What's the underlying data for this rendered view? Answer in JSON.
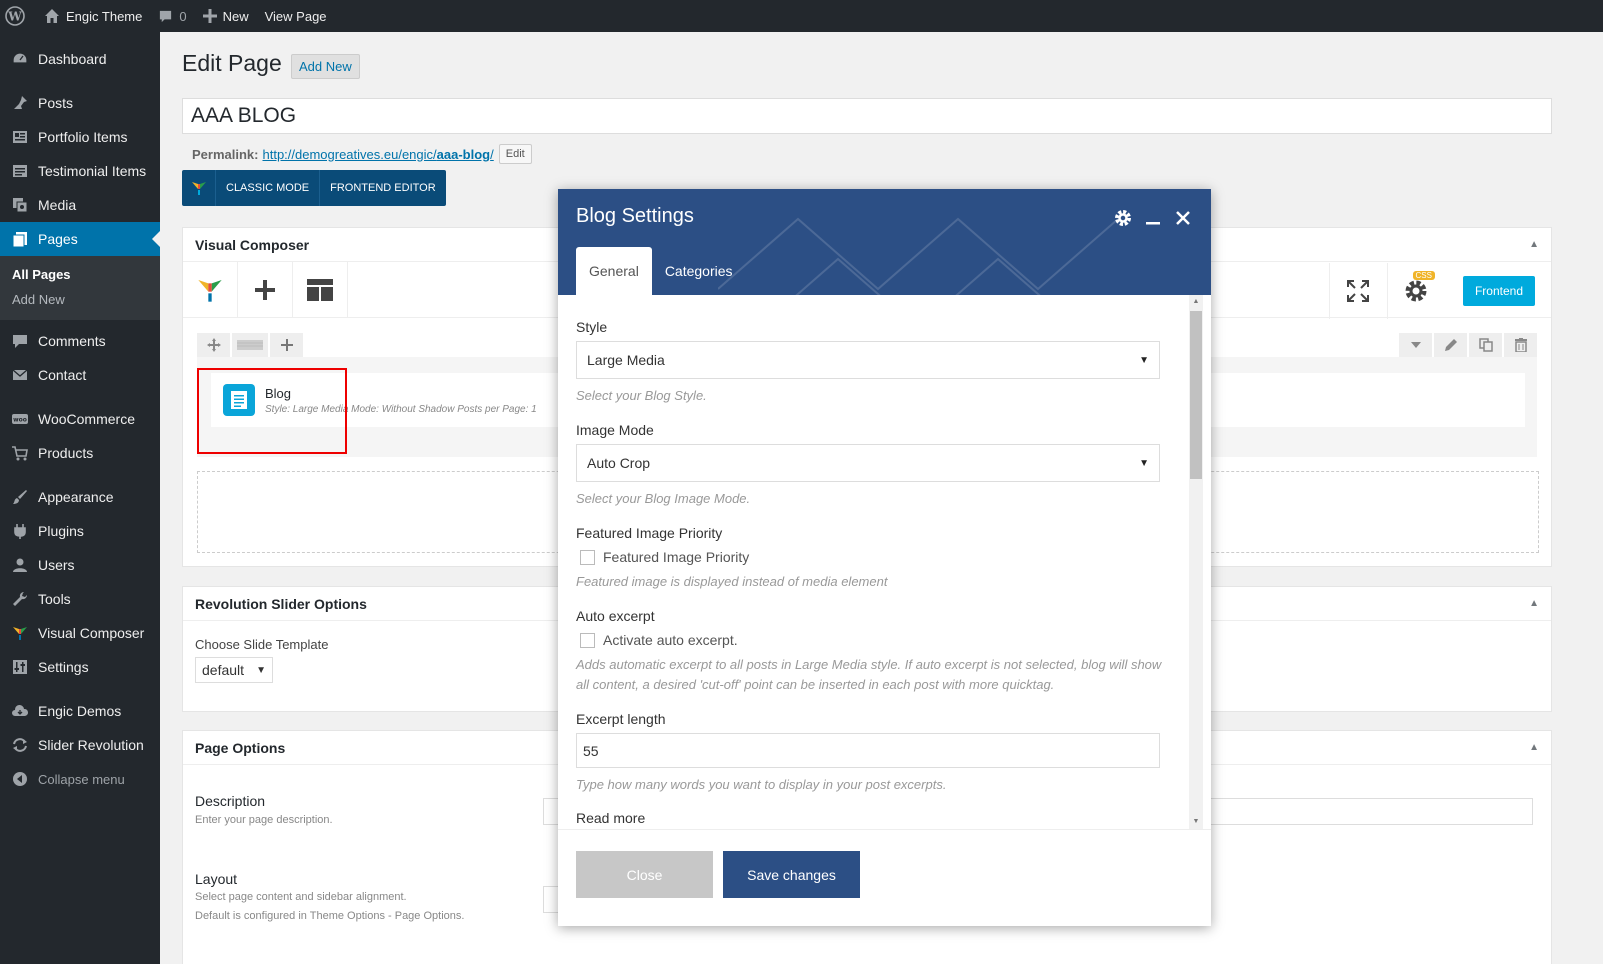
{
  "adminbar": {
    "site_name": "Engic Theme",
    "comments_count": "0",
    "new_label": "New",
    "view_page": "View Page"
  },
  "sidebar": {
    "items": [
      {
        "label": "Dashboard",
        "icon": "dashboard-icon"
      },
      {
        "label": "Posts",
        "icon": "pin-icon"
      },
      {
        "label": "Portfolio Items",
        "icon": "portfolio-icon"
      },
      {
        "label": "Testimonial Items",
        "icon": "testimonial-icon"
      },
      {
        "label": "Media",
        "icon": "media-icon"
      },
      {
        "label": "Pages",
        "icon": "pages-icon"
      },
      {
        "label": "Comments",
        "icon": "comments-icon"
      },
      {
        "label": "Contact",
        "icon": "mail-icon"
      },
      {
        "label": "WooCommerce",
        "icon": "woocommerce-icon"
      },
      {
        "label": "Products",
        "icon": "cart-icon"
      },
      {
        "label": "Appearance",
        "icon": "brush-icon"
      },
      {
        "label": "Plugins",
        "icon": "plugin-icon"
      },
      {
        "label": "Users",
        "icon": "users-icon"
      },
      {
        "label": "Tools",
        "icon": "wrench-icon"
      },
      {
        "label": "Visual Composer",
        "icon": "vc-icon"
      },
      {
        "label": "Settings",
        "icon": "settings-icon"
      },
      {
        "label": "Engic Demos",
        "icon": "cloud-icon"
      },
      {
        "label": "Slider Revolution",
        "icon": "refresh-icon"
      },
      {
        "label": "Collapse menu",
        "icon": "collapse-icon"
      }
    ],
    "pages_sub": {
      "all": "All Pages",
      "add": "Add New"
    }
  },
  "main": {
    "title": "Edit Page",
    "add_new": "Add New",
    "post_title": "AAA BLOG",
    "permalink_label": "Permalink:",
    "permalink_base": "http://demogreatives.eu/engic/",
    "permalink_slug": "aaa-blog",
    "permalink_slash": "/",
    "permalink_edit": "Edit",
    "classic_mode": "CLASSIC MODE",
    "frontend_editor": "FRONTEND EDITOR"
  },
  "vc": {
    "title": "Visual Composer",
    "frontend": "Frontend",
    "css_badge": "CSS",
    "element_title": "Blog",
    "element_params": "Style: Large Media  Mode: Without Shadow  Posts per Page: 1"
  },
  "revolution": {
    "title": "Revolution Slider Options",
    "label": "Choose Slide Template",
    "value": "default"
  },
  "page_options": {
    "title": "Page Options",
    "desc_label": "Description",
    "desc_help": "Enter your page description.",
    "layout_label": "Layout",
    "layout_help1": "Select page content and sidebar alignment.",
    "layout_help2": "Default is configured in Theme Options - Page Options."
  },
  "modal": {
    "title": "Blog Settings",
    "tabs": [
      "General",
      "Categories"
    ],
    "style_label": "Style",
    "style_value": "Large Media",
    "style_help": "Select your Blog Style.",
    "image_mode_label": "Image Mode",
    "image_mode_value": "Auto Crop",
    "image_mode_help": "Select your Blog Image Mode.",
    "featured_label": "Featured Image Priority",
    "featured_check": "Featured Image Priority",
    "featured_help": "Featured image is displayed instead of media element",
    "auto_excerpt_label": "Auto excerpt",
    "auto_excerpt_check": "Activate auto excerpt.",
    "auto_excerpt_help": "Adds automatic excerpt to all posts in Large Media style. If auto excerpt is not selected, blog will show all content, a desired 'cut-off' point can be inserted in each post with more quicktag.",
    "excerpt_length_label": "Excerpt length",
    "excerpt_length_value": "55",
    "excerpt_length_help": "Type how many words you want to display in your post excerpts.",
    "read_more_label": "Read more",
    "close": "Close",
    "save": "Save changes"
  },
  "colors": {
    "admin_dark": "#23282d",
    "accent_blue": "#0073aa",
    "modal_blue": "#2c4f85",
    "vc_frontend": "#00aadd",
    "highlight": "#ee0000"
  }
}
